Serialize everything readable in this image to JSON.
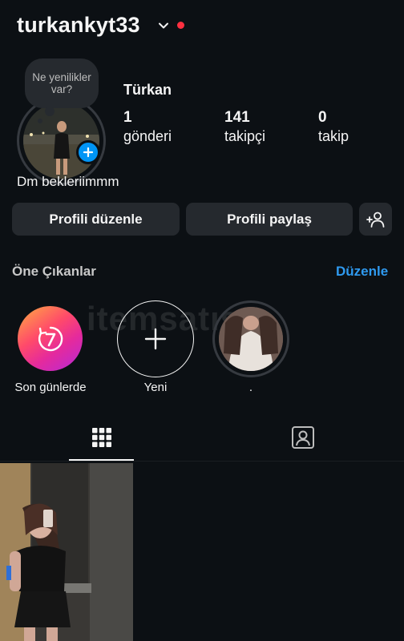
{
  "header": {
    "username": "turkankyt33",
    "icons": [
      "chevron-down-icon",
      "notification-dot"
    ],
    "notification_dot_color": "#ff3040"
  },
  "profile": {
    "note": "Ne yenilikler var?",
    "full_name": "Türkan",
    "bio": "Dm bekleriimmm",
    "stats": [
      {
        "value": "1",
        "label": "gönderi"
      },
      {
        "value": "141",
        "label": "takipçi"
      },
      {
        "value": "0",
        "label": "takip"
      }
    ]
  },
  "actions": {
    "edit_profile": "Profili düzenle",
    "share_profile": "Profili paylaş",
    "add_person_icon": "add-person-icon"
  },
  "highlights": {
    "title": "Öne Çıkanlar",
    "edit_label": "Düzenle",
    "edit_color": "#2f9af0",
    "items": [
      {
        "label": "Son günlerde",
        "icon": "recent-7-icon"
      },
      {
        "label": "Yeni",
        "icon": "plus-icon"
      },
      {
        "label": "."
      }
    ]
  },
  "watermark": "itemsatış",
  "tabs": [
    {
      "name": "grid",
      "icon": "grid-icon",
      "active": true
    },
    {
      "name": "tagged",
      "icon": "tagged-icon",
      "active": false
    }
  ],
  "accent": "#0095f6"
}
